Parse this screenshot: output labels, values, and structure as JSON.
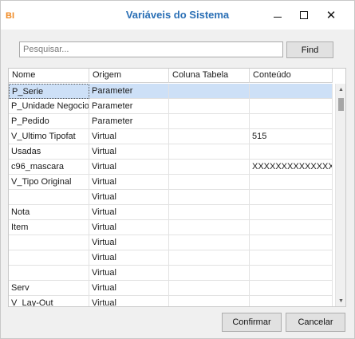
{
  "window": {
    "title": "Variáveis do Sistema",
    "app_icon_label": "BI",
    "controls": {
      "minimize": "minimize-icon",
      "maximize": "maximize-icon",
      "close": "close-icon",
      "close_glyph": "✕"
    }
  },
  "search": {
    "placeholder": "Pesquisar...",
    "value": "",
    "find_label": "Find"
  },
  "grid": {
    "columns": [
      "Nome",
      "Origem",
      "Coluna Tabela",
      "Conteúdo"
    ],
    "rows": [
      [
        "P_Serie",
        "Parameter",
        "",
        ""
      ],
      [
        "P_Unidade Negocio",
        "Parameter",
        "",
        ""
      ],
      [
        "P_Pedido",
        "Parameter",
        "",
        ""
      ],
      [
        "V_Ultimo Tipofat",
        "Virtual",
        "",
        "515"
      ],
      [
        " Usadas",
        "Virtual",
        "",
        ""
      ],
      [
        "c96_mascara",
        "Virtual",
        "",
        "XXXXXXXXXXXXXXXX"
      ],
      [
        "V_Tipo Original",
        "Virtual",
        "",
        ""
      ],
      [
        "",
        "Virtual",
        "",
        ""
      ],
      [
        " Nota",
        "Virtual",
        "",
        ""
      ],
      [
        " Item",
        "Virtual",
        "",
        ""
      ],
      [
        "",
        "Virtual",
        "",
        ""
      ],
      [
        "",
        "Virtual",
        "",
        ""
      ],
      [
        "",
        "Virtual",
        "",
        ""
      ],
      [
        " Serv",
        "Virtual",
        "",
        ""
      ],
      [
        "V_Lay-Out",
        "Virtual",
        "",
        ""
      ]
    ],
    "selected_row": 0,
    "scroll": {
      "up_glyph": "▲",
      "down_glyph": "▼"
    }
  },
  "footer": {
    "confirm_label": "Confirmar",
    "cancel_label": "Cancelar"
  },
  "colors": {
    "title": "#2a6fb5",
    "selection": "#cde0f7",
    "app_icon": "#f08a24"
  }
}
